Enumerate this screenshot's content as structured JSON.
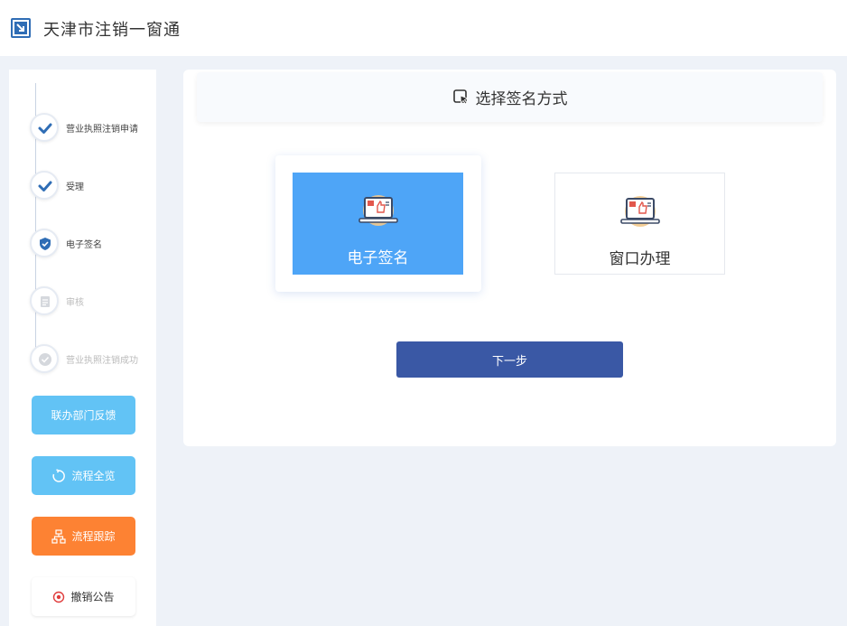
{
  "app": {
    "title": "天津市注销一窗通"
  },
  "steps": [
    {
      "label": "营业执照注销申请",
      "state": "done"
    },
    {
      "label": "受理",
      "state": "done"
    },
    {
      "label": "电子签名",
      "state": "current"
    },
    {
      "label": "审核",
      "state": "pending"
    },
    {
      "label": "营业执照注销成功",
      "state": "pending"
    }
  ],
  "sidebar": {
    "feedback_label": "联办部门反馈",
    "overview_label": "流程全览",
    "track_label": "流程跟踪",
    "notice_label": "撤销公告"
  },
  "main": {
    "header_title": "选择签名方式",
    "options": [
      {
        "label": "电子签名",
        "selected": true
      },
      {
        "label": "窗口办理",
        "selected": false
      }
    ],
    "next_label": "下一步"
  },
  "colors": {
    "primary": "#3a58a5",
    "selected_card": "#4ea5f7",
    "side_blue": "#62c3f5",
    "side_orange": "#fd8233",
    "check": "#2f6db5"
  }
}
